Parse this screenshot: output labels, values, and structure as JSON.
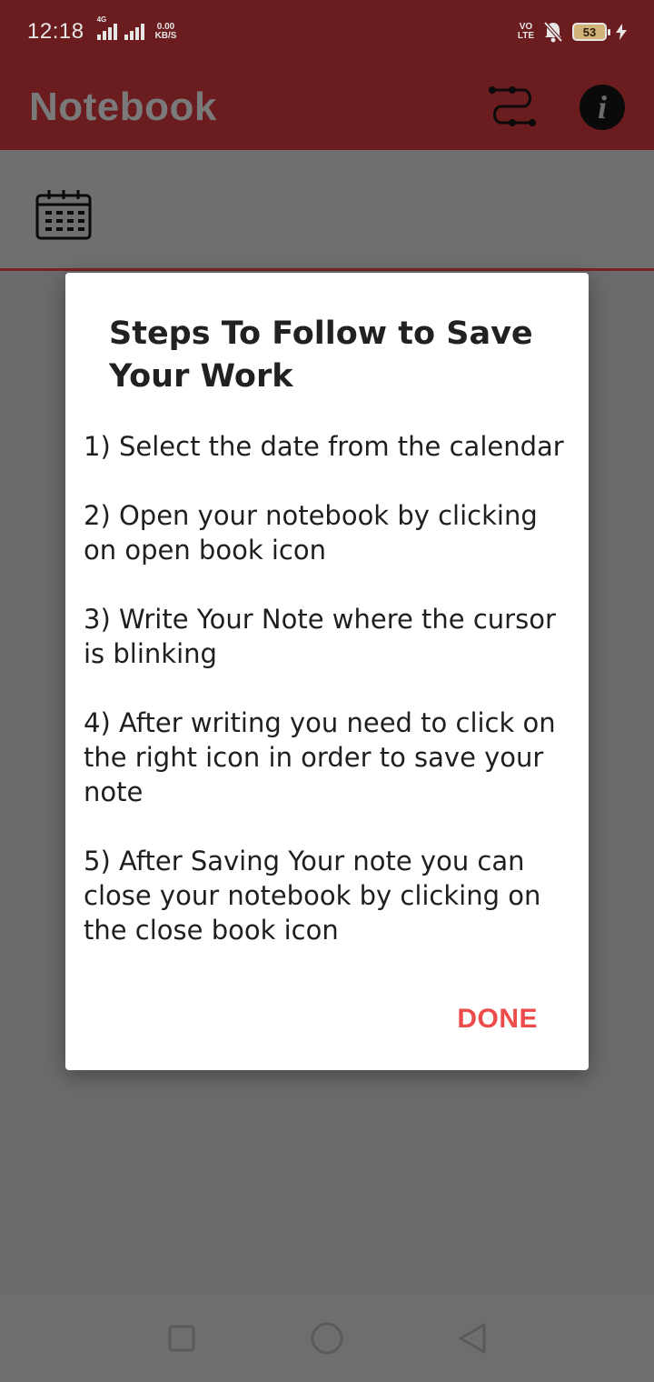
{
  "status_bar": {
    "time": "12:18",
    "network_type": "4G",
    "net_speed_value": "0.00",
    "net_speed_unit": "KB/S",
    "volte_top": "VO",
    "volte_bottom": "LTE",
    "battery_level": "53"
  },
  "app_bar": {
    "title": "Notebook",
    "actions": [
      {
        "name": "switch-icon"
      },
      {
        "name": "info-icon",
        "glyph": "i"
      }
    ]
  },
  "dialog": {
    "title": "Steps To Follow to Save Your Work",
    "steps": [
      "1) Select the date from the calendar",
      "2) Open your notebook by clicking on open book icon",
      "3) Write Your Note where the cursor is blinking",
      "4) After writing you need to click on the right icon in order to save your note",
      "5) After Saving Your note you can close your notebook by clicking on the close book icon"
    ],
    "done_label": "DONE"
  },
  "colors": {
    "app_bar": "#6a1c1e",
    "scrim": "#6b6b6b",
    "accent_button": "#ee4b4b"
  }
}
